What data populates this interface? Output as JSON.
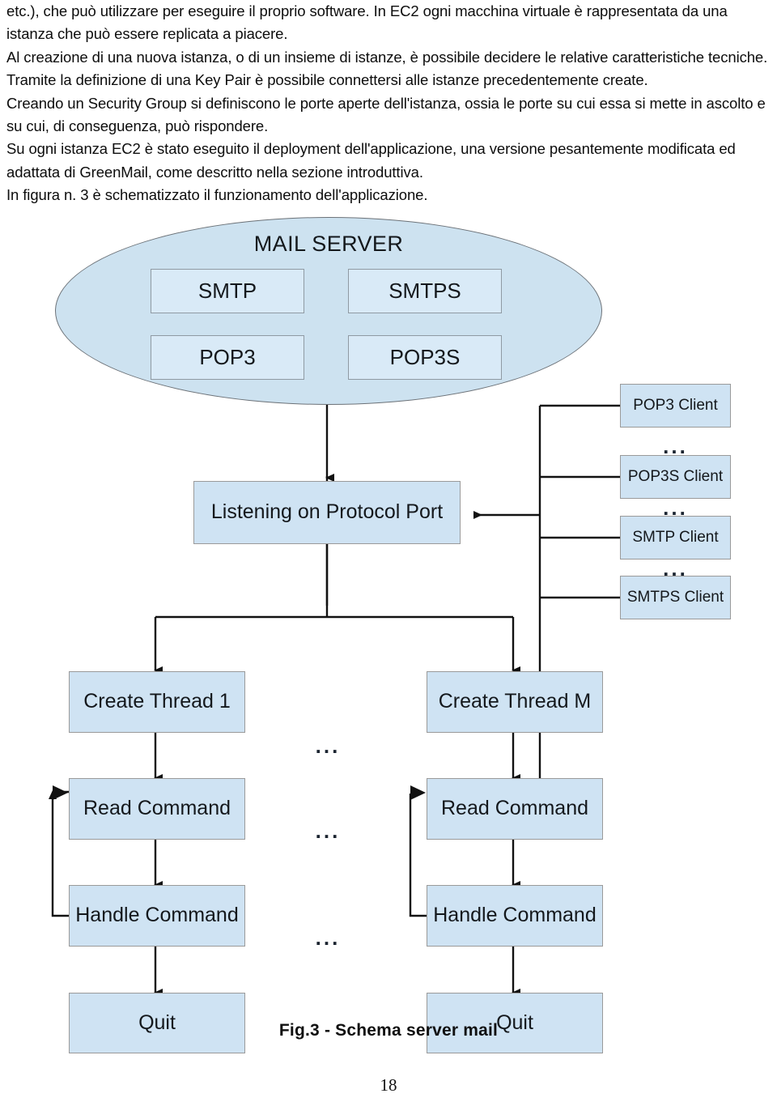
{
  "document": {
    "page_number": "18",
    "body_paragraphs": [
      "etc.), che può utilizzare per eseguire il proprio software. In EC2 ogni macchina virtuale è rappresentata da una istanza che può essere replicata a piacere.",
      "Al creazione di una nuova istanza, o di un insieme di istanze, è possibile decidere le relative caratteristiche tecniche. Tramite la definizione di una Key Pair è possibile connettersi alle istanze precedentemente create.",
      "Creando un Security Group si definiscono le porte aperte dell'istanza, ossia le porte su cui essa si mette in ascolto e su cui, di conseguenza, può rispondere.",
      "Su ogni istanza EC2 è stato eseguito il deployment dell'applicazione, una versione pesantemente modificata ed adattata di GreenMail, come descritto nella sezione introduttiva.",
      "In figura n. 3 è schematizzato il funzionamento dell'applicazione."
    ]
  },
  "figure": {
    "caption": "Fig.3 - Schema server mail",
    "colors": {
      "node_fill": "#cfe3f3",
      "node_border": "#9a9a9a",
      "ellipse_fill": "#cde2f0",
      "ellipse_border": "#6c7278",
      "connector": "#121212"
    },
    "mail_server": {
      "title": "MAIL SERVER",
      "protocols": [
        "SMTP",
        "SMTPS",
        "POP3",
        "POP3S"
      ]
    },
    "listening_node": "Listening on Protocol Port",
    "clients": [
      "POP3 Client",
      "POP3S Client",
      "SMTP Client",
      "SMTPS Client"
    ],
    "client_separator": "...",
    "thread_columns": [
      {
        "create": "Create Thread 1",
        "read": "Read Command",
        "handle": "Handle Command",
        "quit": "Quit"
      },
      {
        "create": "Create Thread M",
        "read": "Read Command",
        "handle": "Handle Command",
        "quit": "Quit"
      }
    ],
    "column_separators": [
      "...",
      "...",
      "..."
    ]
  }
}
